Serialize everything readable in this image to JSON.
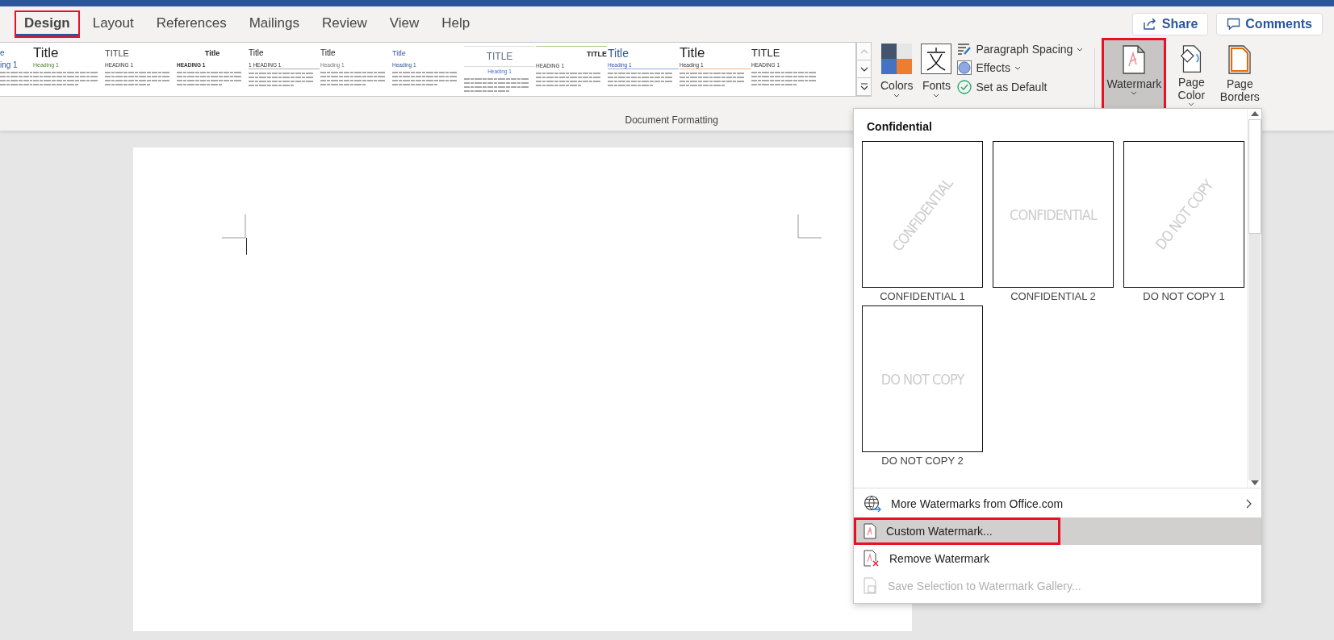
{
  "tabs": [
    {
      "label": "Design",
      "selected": true,
      "highlighted": true
    },
    {
      "label": "Layout",
      "selected": false,
      "highlighted": false
    },
    {
      "label": "References",
      "selected": false,
      "highlighted": false
    },
    {
      "label": "Mailings",
      "selected": false,
      "highlighted": false
    },
    {
      "label": "Review",
      "selected": false,
      "highlighted": false
    },
    {
      "label": "View",
      "selected": false,
      "highlighted": false
    },
    {
      "label": "Help",
      "selected": false,
      "highlighted": false
    }
  ],
  "share_button": "Share",
  "comments_button": "Comments",
  "style_gallery": [
    {
      "kind": "cut",
      "title": "e",
      "heading": "ing 1"
    },
    {
      "kind": "plain",
      "title": "Title",
      "heading": "Heading 1"
    },
    {
      "kind": "caps",
      "title": "TITLE",
      "heading": "HEADING 1"
    },
    {
      "kind": "centered",
      "title": "Title",
      "heading": "HEADING 1"
    },
    {
      "kind": "numbered",
      "title": "Title",
      "heading": "1 HEADING 1"
    },
    {
      "kind": "soft",
      "title": "Title",
      "heading": "Heading 1"
    },
    {
      "kind": "blue",
      "title": "Title",
      "heading": "Heading 1"
    },
    {
      "kind": "lined",
      "title": "TITLE",
      "heading": "Heading 1"
    },
    {
      "kind": "right",
      "title": "TITLE",
      "heading": "HEADING 1"
    },
    {
      "kind": "blue-rule",
      "title": "Title",
      "heading": "Heading 1"
    },
    {
      "kind": "orange-rule",
      "title": "Title",
      "heading": "Heading 1"
    },
    {
      "kind": "bold-caps",
      "title": "TITLE",
      "heading": "HEADING 1"
    }
  ],
  "group_label": "Document Formatting",
  "colors_button": "Colors",
  "fonts_button": "Fonts",
  "paragraph_spacing": "Paragraph Spacing",
  "effects": "Effects",
  "set_as_default": "Set as Default",
  "page_buttons": [
    {
      "kind": "watermark",
      "label": "Watermark",
      "selected": true,
      "highlighted": true
    },
    {
      "kind": "page-color",
      "label": "Page Color",
      "selected": false,
      "highlighted": false
    },
    {
      "kind": "page-borders",
      "label": "Page Borders",
      "selected": false,
      "highlighted": false
    }
  ],
  "watermark_menu": {
    "section": "Confidential",
    "gallery": [
      {
        "kind": "diagonal",
        "text": "CONFIDENTIAL",
        "caption": "CONFIDENTIAL 1"
      },
      {
        "kind": "horizontal",
        "text": "CONFIDENTIAL",
        "caption": "CONFIDENTIAL 2"
      },
      {
        "kind": "diagonal",
        "text": "DO NOT COPY",
        "caption": "DO NOT COPY 1"
      },
      {
        "kind": "horizontal",
        "text": "DO NOT COPY",
        "caption": "DO NOT COPY 2"
      }
    ],
    "items": [
      {
        "kind": "globe",
        "label": "More Watermarks from Office.com",
        "submenu": true,
        "selected": false,
        "highlighted": false,
        "disabled": false
      },
      {
        "kind": "custom",
        "label": "Custom Watermark...",
        "submenu": false,
        "selected": true,
        "highlighted": true,
        "disabled": false
      },
      {
        "kind": "remove",
        "label": "Remove Watermark",
        "submenu": false,
        "selected": false,
        "highlighted": false,
        "disabled": false
      },
      {
        "kind": "save",
        "label": "Save Selection to Watermark Gallery...",
        "submenu": false,
        "selected": false,
        "highlighted": false,
        "disabled": true
      }
    ]
  }
}
